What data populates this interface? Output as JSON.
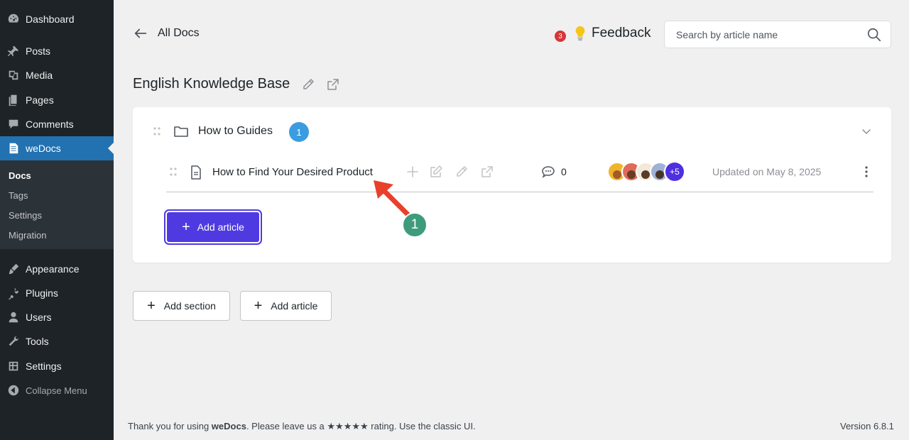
{
  "sidebar": {
    "items": [
      {
        "label": "Dashboard",
        "icon": "dashboard-icon"
      },
      {
        "label": "Posts",
        "icon": "pin-icon"
      },
      {
        "label": "Media",
        "icon": "media-icon"
      },
      {
        "label": "Pages",
        "icon": "pages-icon"
      },
      {
        "label": "Comments",
        "icon": "comment-icon"
      },
      {
        "label": "weDocs",
        "icon": "docs-icon",
        "active": true
      },
      {
        "label": "Appearance",
        "icon": "brush-icon"
      },
      {
        "label": "Plugins",
        "icon": "plug-icon"
      },
      {
        "label": "Users",
        "icon": "user-icon"
      },
      {
        "label": "Tools",
        "icon": "wrench-icon"
      },
      {
        "label": "Settings",
        "icon": "settings-icon"
      },
      {
        "label": "Collapse Menu",
        "icon": "collapse-icon"
      }
    ],
    "submenu": [
      "Docs",
      "Tags",
      "Settings",
      "Migration"
    ]
  },
  "header": {
    "back_label": "All Docs",
    "notification_count": "3",
    "feedback_label": "Feedback",
    "search_placeholder": "Search by article name"
  },
  "knowledge_base": {
    "title": "English Knowledge Base"
  },
  "section": {
    "title": "How to Guides",
    "count": "1",
    "articles": [
      {
        "title": "How to Find Your Desired Product",
        "comments": "0",
        "contributors_more": "+5",
        "updated": "Updated on May 8, 2025"
      }
    ],
    "add_article_label": "Add article"
  },
  "annotation": {
    "number": "1"
  },
  "actions": {
    "add_section": "Add section",
    "add_article": "Add article"
  },
  "footer": {
    "prefix": "Thank you for using ",
    "brand": "weDocs",
    "suffix": ". Please leave us a ★★★★★ rating. Use the classic UI.",
    "version": "Version 6.8.1"
  },
  "colors": {
    "sidebar_bg": "#1d2327",
    "active_menu": "#2271b1",
    "primary_button": "#4f3ae2",
    "count_badge": "#3b9ddf",
    "annotation_arrow": "#e8402b",
    "annotation_badge": "#3e9b7c"
  }
}
